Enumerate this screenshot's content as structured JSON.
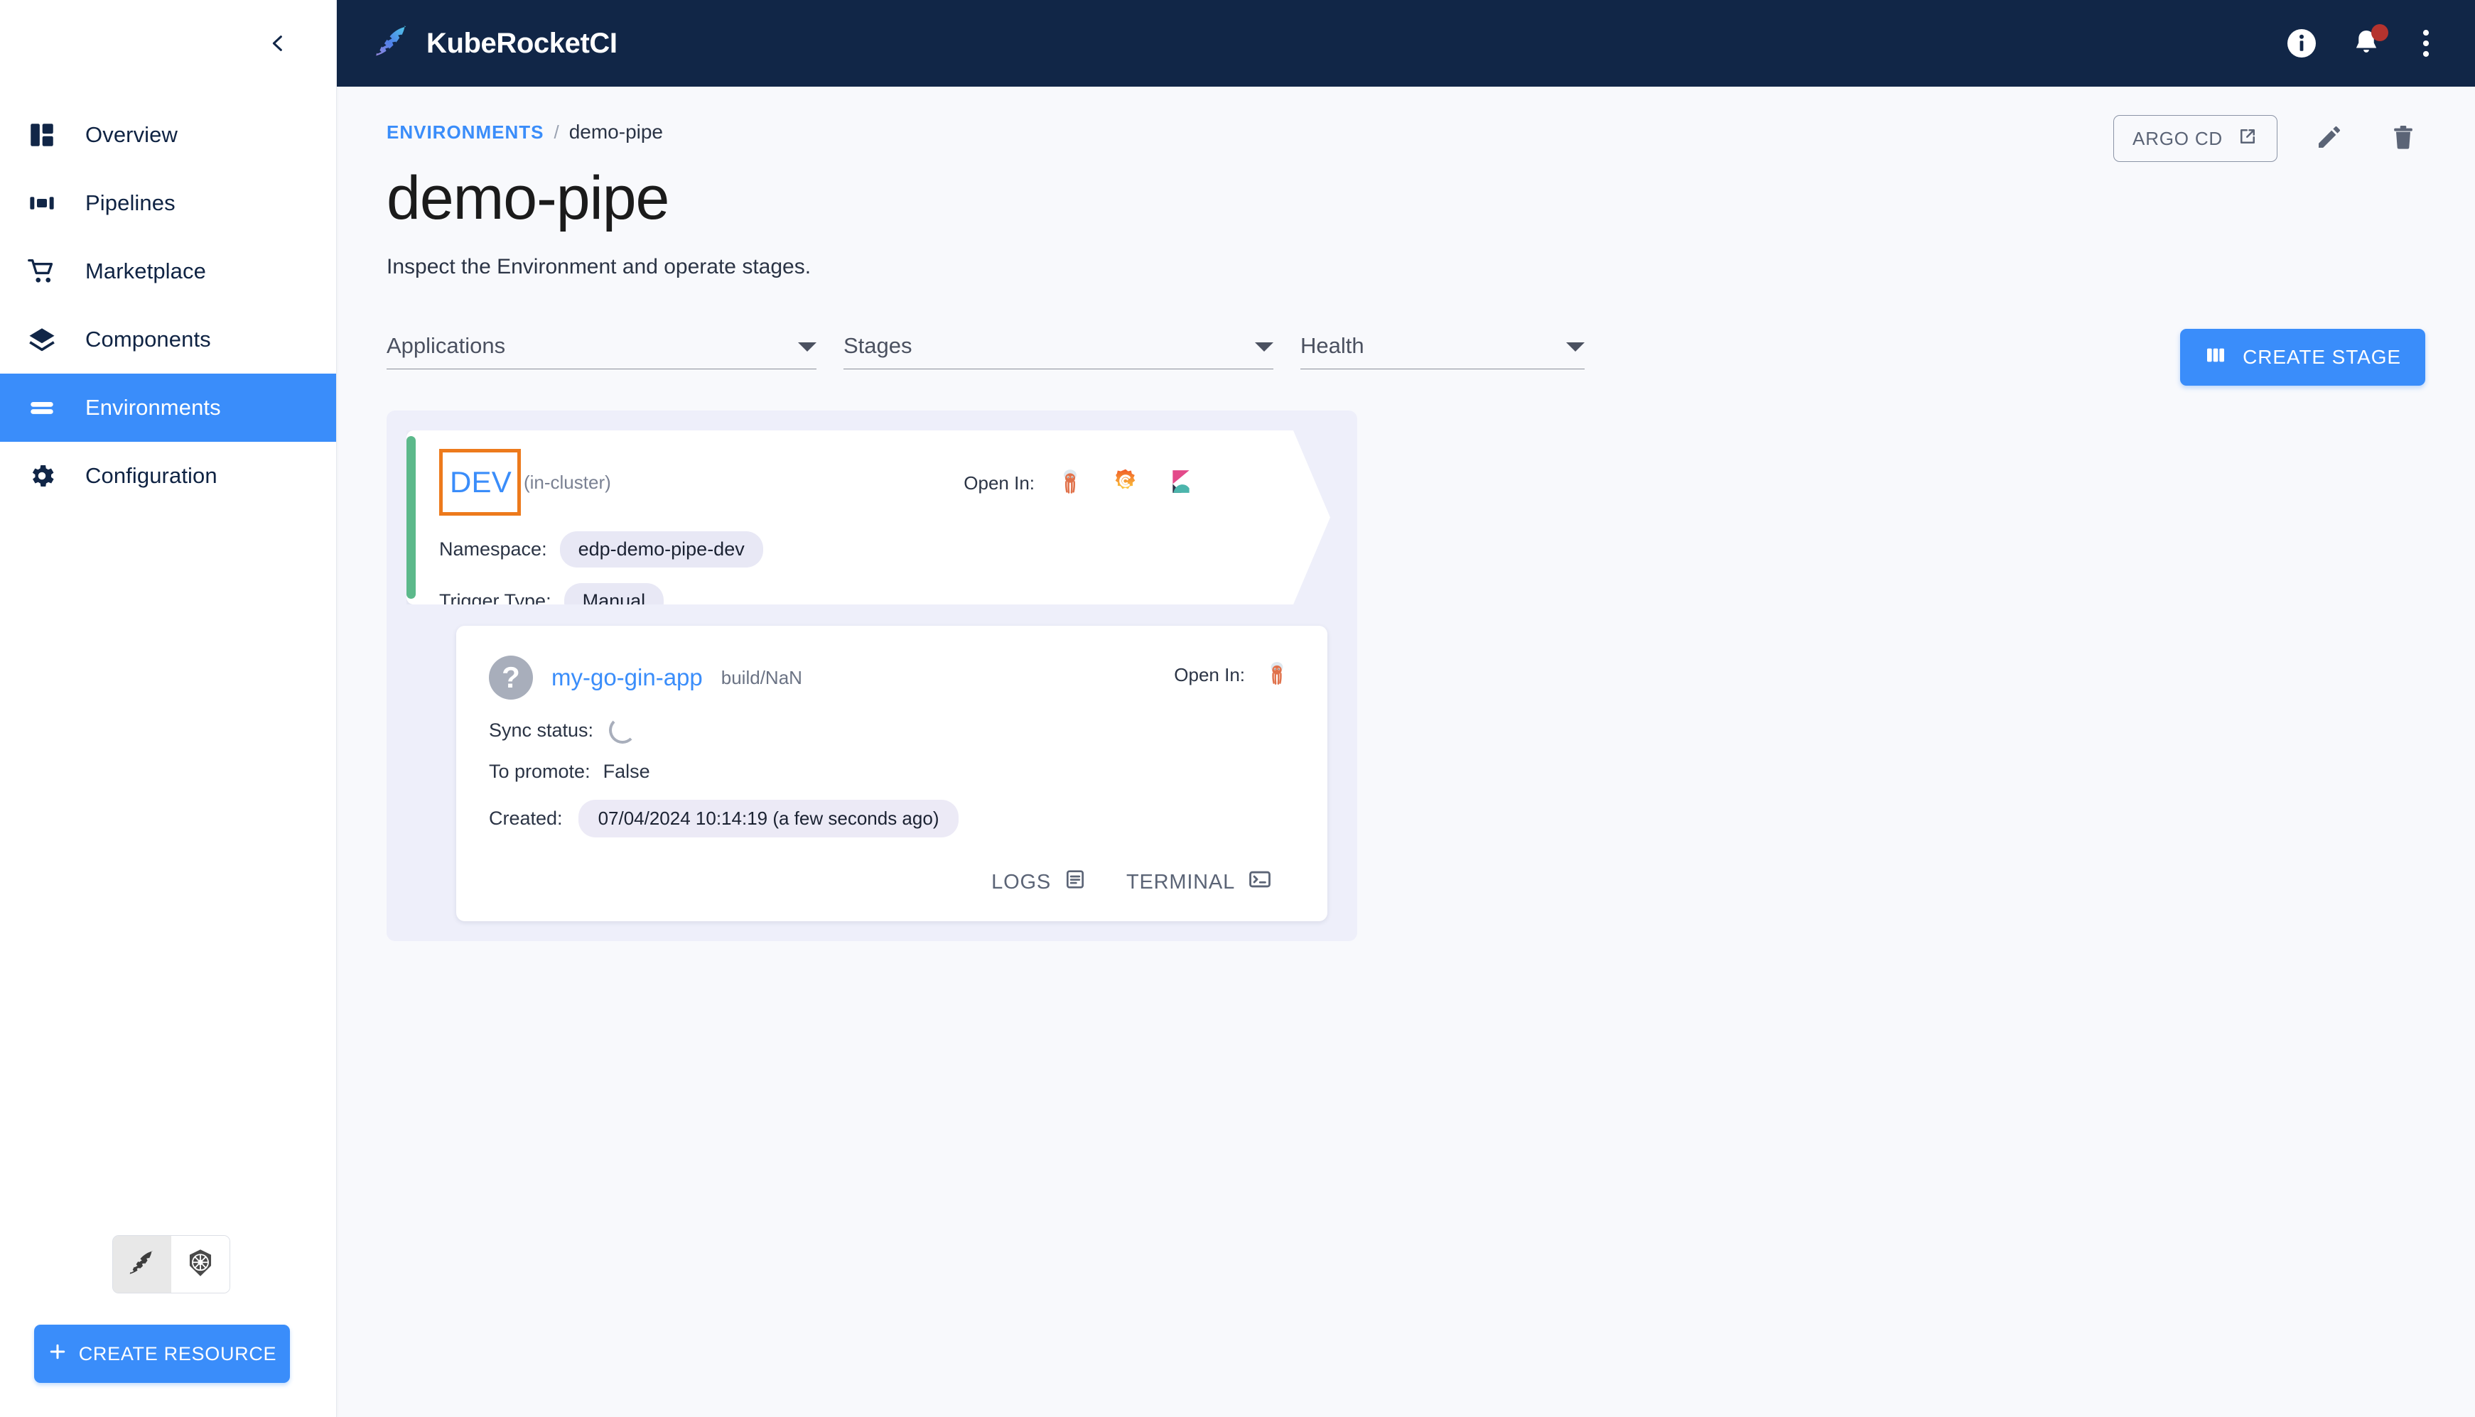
{
  "app": {
    "brand_name": "KubeRocketCI",
    "logo_icon": "rocket-feather-icon"
  },
  "topbar": {
    "info_icon": "info-circle-icon",
    "notifications_icon": "bell-icon",
    "more_icon": "more-vertical-icon"
  },
  "sidebar": {
    "collapse_icon": "chevron-left-icon",
    "items": [
      {
        "label": "Overview",
        "icon": "dashboard-icon",
        "active": false
      },
      {
        "label": "Pipelines",
        "icon": "pipeline-icon",
        "active": false
      },
      {
        "label": "Marketplace",
        "icon": "cart-icon",
        "active": false
      },
      {
        "label": "Components",
        "icon": "layers-icon",
        "active": false
      },
      {
        "label": "Environments",
        "icon": "environments-icon",
        "active": true
      },
      {
        "label": "Configuration",
        "icon": "gear-icon",
        "active": false
      }
    ],
    "mode_toggle": {
      "options": [
        {
          "icon": "kuberocketci-feather-icon",
          "selected": true
        },
        {
          "icon": "kubernetes-wheel-icon",
          "selected": false
        }
      ]
    },
    "create_resource_label": "CREATE RESOURCE",
    "create_resource_icon": "plus-icon"
  },
  "breadcrumb": {
    "root": "ENVIRONMENTS",
    "separator": "/",
    "current": "demo-pipe"
  },
  "page": {
    "title": "demo-pipe",
    "subtitle": "Inspect the Environment and operate stages."
  },
  "header_actions": {
    "argocd_label": "ARGO CD",
    "argocd_icon": "external-link-icon",
    "edit_icon": "pencil-icon",
    "delete_icon": "trash-icon"
  },
  "filters": [
    {
      "label": "Applications",
      "icon": "chevron-down-icon"
    },
    {
      "label": "Stages",
      "icon": "chevron-down-icon"
    },
    {
      "label": "Health",
      "icon": "chevron-down-icon"
    }
  ],
  "create_stage": {
    "label": "CREATE STAGE",
    "icon": "columns-icon"
  },
  "stage": {
    "name": "DEV",
    "cluster": "(in-cluster)",
    "health_color": "#5cb98b",
    "selection_color": "#ed7a1c",
    "open_in_label": "Open In:",
    "open_in_icons": [
      "opensearch-icon",
      "grafana-icon",
      "kibana-icon"
    ],
    "fields": [
      {
        "key": "Namespace:",
        "value": "edp-demo-pipe-dev"
      },
      {
        "key": "Trigger Type:",
        "value": "Manual"
      }
    ]
  },
  "application": {
    "status_icon": "question-mark-icon",
    "name": "my-go-gin-app",
    "build": "build/NaN",
    "open_in_label": "Open In:",
    "open_in_icons": [
      "opensearch-icon"
    ],
    "sync_status_key": "Sync status:",
    "sync_status_icon": "spinner-icon",
    "to_promote_key": "To promote:",
    "to_promote_value": "False",
    "created_key": "Created:",
    "created_value": "07/04/2024 10:14:19 (a few seconds ago)",
    "actions": [
      {
        "label": "LOGS",
        "icon": "logs-icon"
      },
      {
        "label": "TERMINAL",
        "icon": "terminal-icon"
      }
    ]
  },
  "colors": {
    "accent": "#3a8dfa",
    "topbar_bg": "#112647",
    "page_bg": "#f8f9fc",
    "group_bg": "#eeeffa",
    "health_green": "#5cb98b",
    "selection_orange": "#ed7a1c",
    "badge_red": "#b5332e"
  }
}
